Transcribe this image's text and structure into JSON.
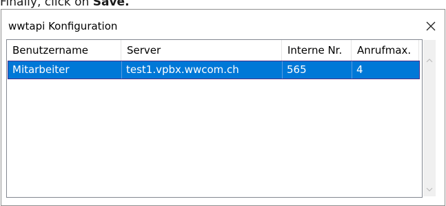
{
  "instruction": {
    "prefix": "Finally, click on ",
    "action": "Save."
  },
  "window": {
    "title": "wwtapi Konfiguration",
    "close_symbol": "×"
  },
  "table": {
    "columns": [
      "Benutzername",
      "Server",
      "Interne Nr.",
      "Anrufmax."
    ],
    "rows": [
      {
        "selected": true,
        "cells": [
          "Mitarbeiter",
          "test1.vpbx.wwcom.ch",
          "565",
          "4"
        ]
      }
    ]
  },
  "colors": {
    "selection": "#0078d7",
    "selection_border": "#4a2f8a",
    "border": "#828790"
  },
  "icons": {
    "close": "close-icon",
    "scroll_up": "chevron-up-icon",
    "scroll_down": "chevron-down-icon"
  }
}
